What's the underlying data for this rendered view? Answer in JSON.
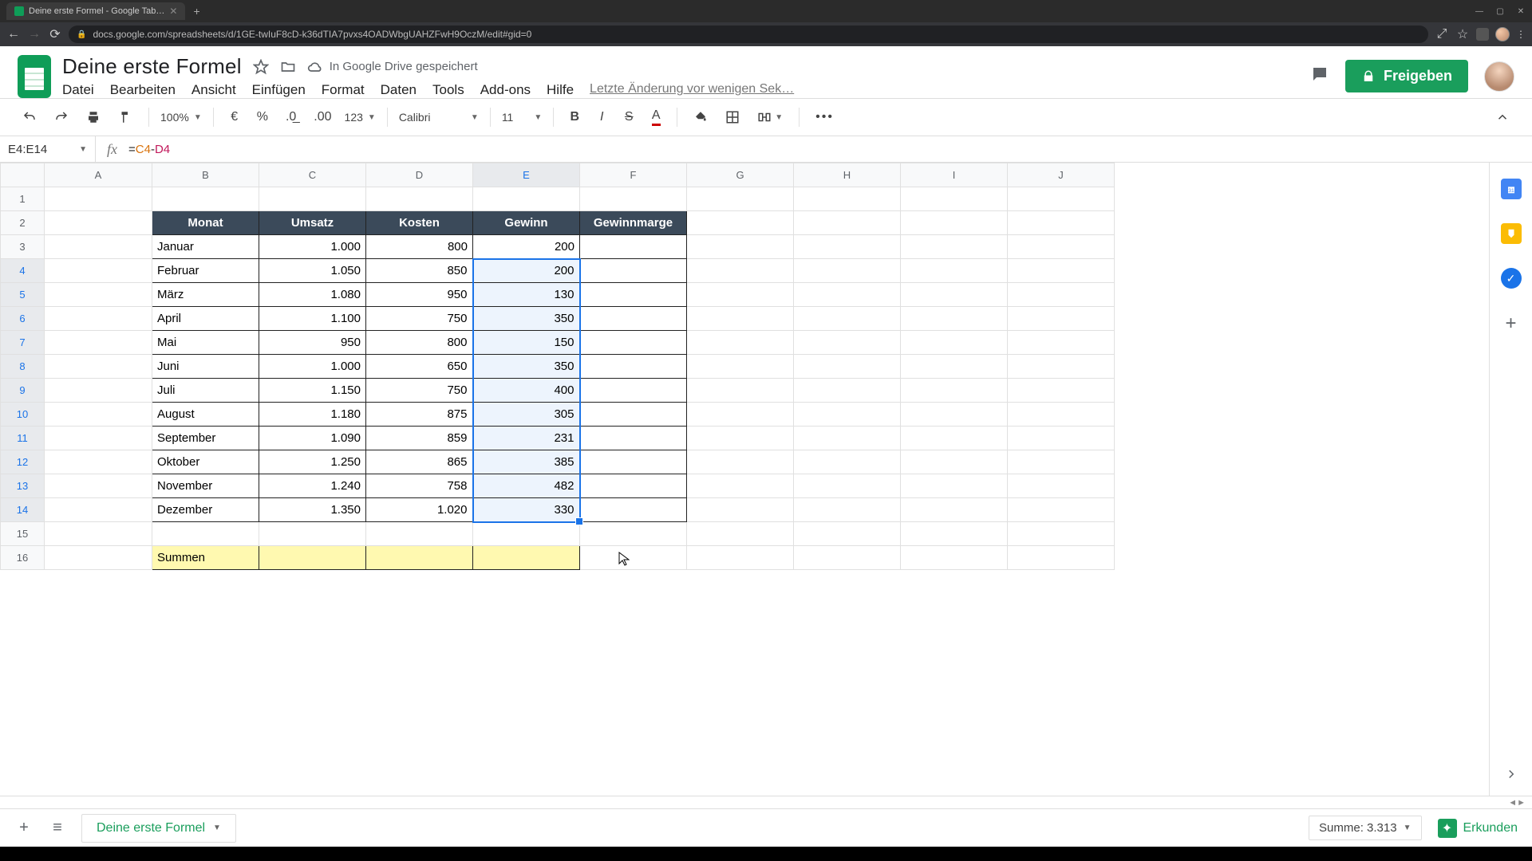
{
  "browser": {
    "tab_title": "Deine erste Formel - Google Tab…",
    "url": "docs.google.com/spreadsheets/d/1GE-twIuF8cD-k36dTIA7pvxs4OADWbgUAHZFwH9OczM/edit#gid=0"
  },
  "doc": {
    "title": "Deine erste Formel",
    "saved_label": "In Google Drive gespeichert",
    "share_label": "Freigeben",
    "last_edit": "Letzte Änderung vor wenigen Sek…"
  },
  "menu": {
    "file": "Datei",
    "edit": "Bearbeiten",
    "view": "Ansicht",
    "insert": "Einfügen",
    "format": "Format",
    "data": "Daten",
    "tools": "Tools",
    "addons": "Add-ons",
    "help": "Hilfe"
  },
  "toolbar": {
    "zoom": "100%",
    "currency": "€",
    "percent": "%",
    "dec_dec": ".0",
    "inc_dec": ".00",
    "numfmt": "123",
    "font": "Calibri",
    "size": "11",
    "more": "•••"
  },
  "namebox": "E4:E14",
  "formula": {
    "eq": "=",
    "r1": "C4",
    "op": "-",
    "r2": "D4"
  },
  "columns": [
    "A",
    "B",
    "C",
    "D",
    "E",
    "F",
    "G",
    "H",
    "I",
    "J"
  ],
  "table": {
    "headers": {
      "monat": "Monat",
      "umsatz": "Umsatz",
      "kosten": "Kosten",
      "gewinn": "Gewinn",
      "marge": "Gewinnmarge"
    },
    "rows": [
      {
        "monat": "Januar",
        "umsatz": "1.000",
        "kosten": "800",
        "gewinn": "200"
      },
      {
        "monat": "Februar",
        "umsatz": "1.050",
        "kosten": "850",
        "gewinn": "200"
      },
      {
        "monat": "März",
        "umsatz": "1.080",
        "kosten": "950",
        "gewinn": "130"
      },
      {
        "monat": "April",
        "umsatz": "1.100",
        "kosten": "750",
        "gewinn": "350"
      },
      {
        "monat": "Mai",
        "umsatz": "950",
        "kosten": "800",
        "gewinn": "150"
      },
      {
        "monat": "Juni",
        "umsatz": "1.000",
        "kosten": "650",
        "gewinn": "350"
      },
      {
        "monat": "Juli",
        "umsatz": "1.150",
        "kosten": "750",
        "gewinn": "400"
      },
      {
        "monat": "August",
        "umsatz": "1.180",
        "kosten": "875",
        "gewinn": "305"
      },
      {
        "monat": "September",
        "umsatz": "1.090",
        "kosten": "859",
        "gewinn": "231"
      },
      {
        "monat": "Oktober",
        "umsatz": "1.250",
        "kosten": "865",
        "gewinn": "385"
      },
      {
        "monat": "November",
        "umsatz": "1.240",
        "kosten": "758",
        "gewinn": "482"
      },
      {
        "monat": "Dezember",
        "umsatz": "1.350",
        "kosten": "1.020",
        "gewinn": "330"
      }
    ],
    "summen": "Summen"
  },
  "bottom": {
    "sheet_name": "Deine erste Formel",
    "sum_label": "Summe: 3.313",
    "explore": "Erkunden"
  }
}
